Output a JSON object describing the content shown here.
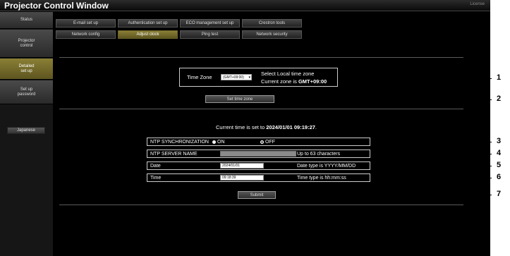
{
  "window": {
    "title": "Projector Control Window",
    "license": "License"
  },
  "sidebar": {
    "items": [
      {
        "label": "Status"
      },
      {
        "label": "Projector\ncontrol"
      },
      {
        "label": "Detailed\nset up"
      },
      {
        "label": "Set up\npassword"
      }
    ],
    "language_button": "Japanese"
  },
  "tabs": [
    {
      "label": "E-mail set up"
    },
    {
      "label": "Authentication set up"
    },
    {
      "label": "ECO management set up"
    },
    {
      "label": "Crestron tools"
    },
    {
      "label": "Network config"
    },
    {
      "label": "Adjust clock"
    },
    {
      "label": "Ping test"
    },
    {
      "label": "Network security"
    }
  ],
  "timezone": {
    "label": "Time Zone",
    "selected": "(GMT+09:00)",
    "info_line1": "Select Local time zone",
    "info_prefix": "Current zone is ",
    "info_value": "GMT+09:00",
    "set_button": "Set time zone"
  },
  "current_time": {
    "prefix": "Current time is set to ",
    "value": "2024/01/01 09:19:27",
    "suffix": "."
  },
  "form": {
    "ntp_sync": {
      "label": "NTP SYNCHRONIZATION",
      "on": "ON",
      "off": "OFF"
    },
    "ntp_server": {
      "label": "NTP SERVER NAME",
      "value": "",
      "note": "Up to 63 characters"
    },
    "date": {
      "label": "Date",
      "value": "2024/01/01",
      "note": "Date type is YYYY/MM/DD"
    },
    "time": {
      "label": "Time",
      "value": "09:18:39",
      "note": "Time type is hh:mm:ss"
    },
    "submit": "Submit"
  },
  "callouts": [
    "1",
    "2",
    "3",
    "4",
    "5",
    "6",
    "7"
  ]
}
